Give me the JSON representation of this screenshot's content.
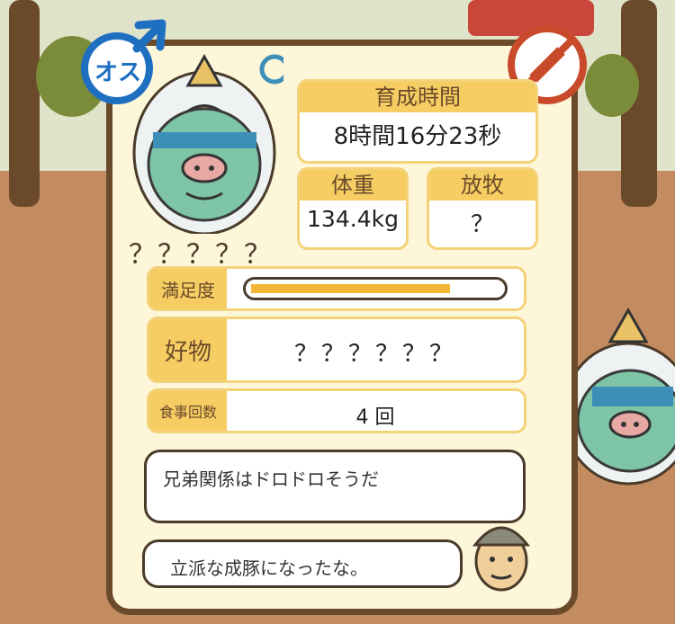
{
  "character": {
    "gender_label": "オス",
    "name": "？？？？？"
  },
  "stats": {
    "growth_time": {
      "label": "育成時間",
      "value": "8時間16分23秒"
    },
    "weight": {
      "label": "体重",
      "value": "134.4kg"
    },
    "grazing": {
      "label": "放牧",
      "value": "？"
    },
    "satisfaction": {
      "label": "満足度",
      "level": 0.8
    },
    "favorite": {
      "label": "好物",
      "value": "？？？？？？"
    },
    "meals": {
      "label": "食事回数",
      "value": "4 回"
    }
  },
  "dialogue": {
    "line1": "兄弟関係はドロドロそうだ",
    "line2": "立派な成豚になったな。"
  },
  "colors": {
    "frame": "#6b4a2b",
    "card": "#fdf6d9",
    "label_bg": "#f6cd62",
    "gender_blue": "#1f6fc1",
    "no_injection_red": "#c94a2a",
    "bar_fill": "#f2b733"
  },
  "icons": {
    "gender": "male-symbol-icon",
    "no_injection": "no-syringe-icon"
  }
}
